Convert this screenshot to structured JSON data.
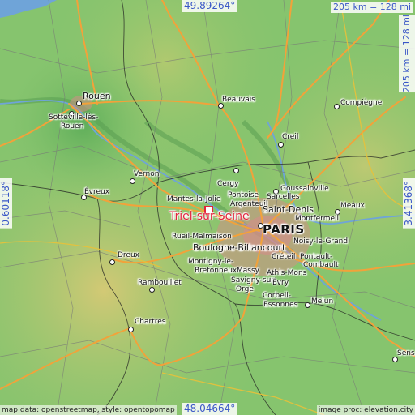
{
  "map": {
    "coordinates": {
      "top": "49.89264°",
      "bottom": "48.04664°",
      "left": "0.60118°",
      "right": "3.41368°"
    },
    "scale": {
      "horizontal": "205 km = 128 mi",
      "vertical": "205 km = 128 mi"
    },
    "credits": {
      "left": "map data: openstreetmap, style: opentopomap",
      "right": "image proc: elevation.city"
    },
    "target": {
      "name": "Triel-sur-Seine",
      "marker_color": "#e2233a"
    },
    "capital": "PARIS",
    "cities": {
      "rouen": "Rouen",
      "sotteville": "Sotteville-lès-Rouen",
      "beauvais": "Beauvais",
      "compiegne": "Compiègne",
      "creil": "Creil",
      "vernon": "Vernon",
      "cergy": "Cergy",
      "evreux": "Évreux",
      "mantes": "Mantes-la-Jolie",
      "pontoise": "Pontoise",
      "argenteuil": "Argenteuil",
      "goussainville": "Goussainville",
      "sarcelles": "Sarcelles",
      "saint_denis": "Saint-Denis",
      "meaux": "Meaux",
      "montfermeil": "Montfermeil",
      "rueil": "Rueil-Malmaison",
      "boulogne": "Boulogne-Billancourt",
      "noisy": "Noisy-le-Grand",
      "dreux": "Dreux",
      "creteil": "Créteil",
      "pontault": "Pontault-Combault",
      "montigny": "Montigny-le-Bretonneux",
      "massy": "Massy",
      "athis": "Athis-Mons",
      "savigny": "Savigny-sur-Orge",
      "evry": "Évry",
      "rambouillet": "Rambouillet",
      "corbeil": "Corbeil-Essonnes",
      "melun": "Melun",
      "chartres": "Chartres",
      "sens": "Sens"
    },
    "colors": {
      "lowland": "#86c46e",
      "highland": "#c9c26a",
      "roads_major": "#f2a23a",
      "water": "#6fa4d8",
      "urban": "#d98a8a",
      "label_blue": "#3a57c7"
    }
  }
}
